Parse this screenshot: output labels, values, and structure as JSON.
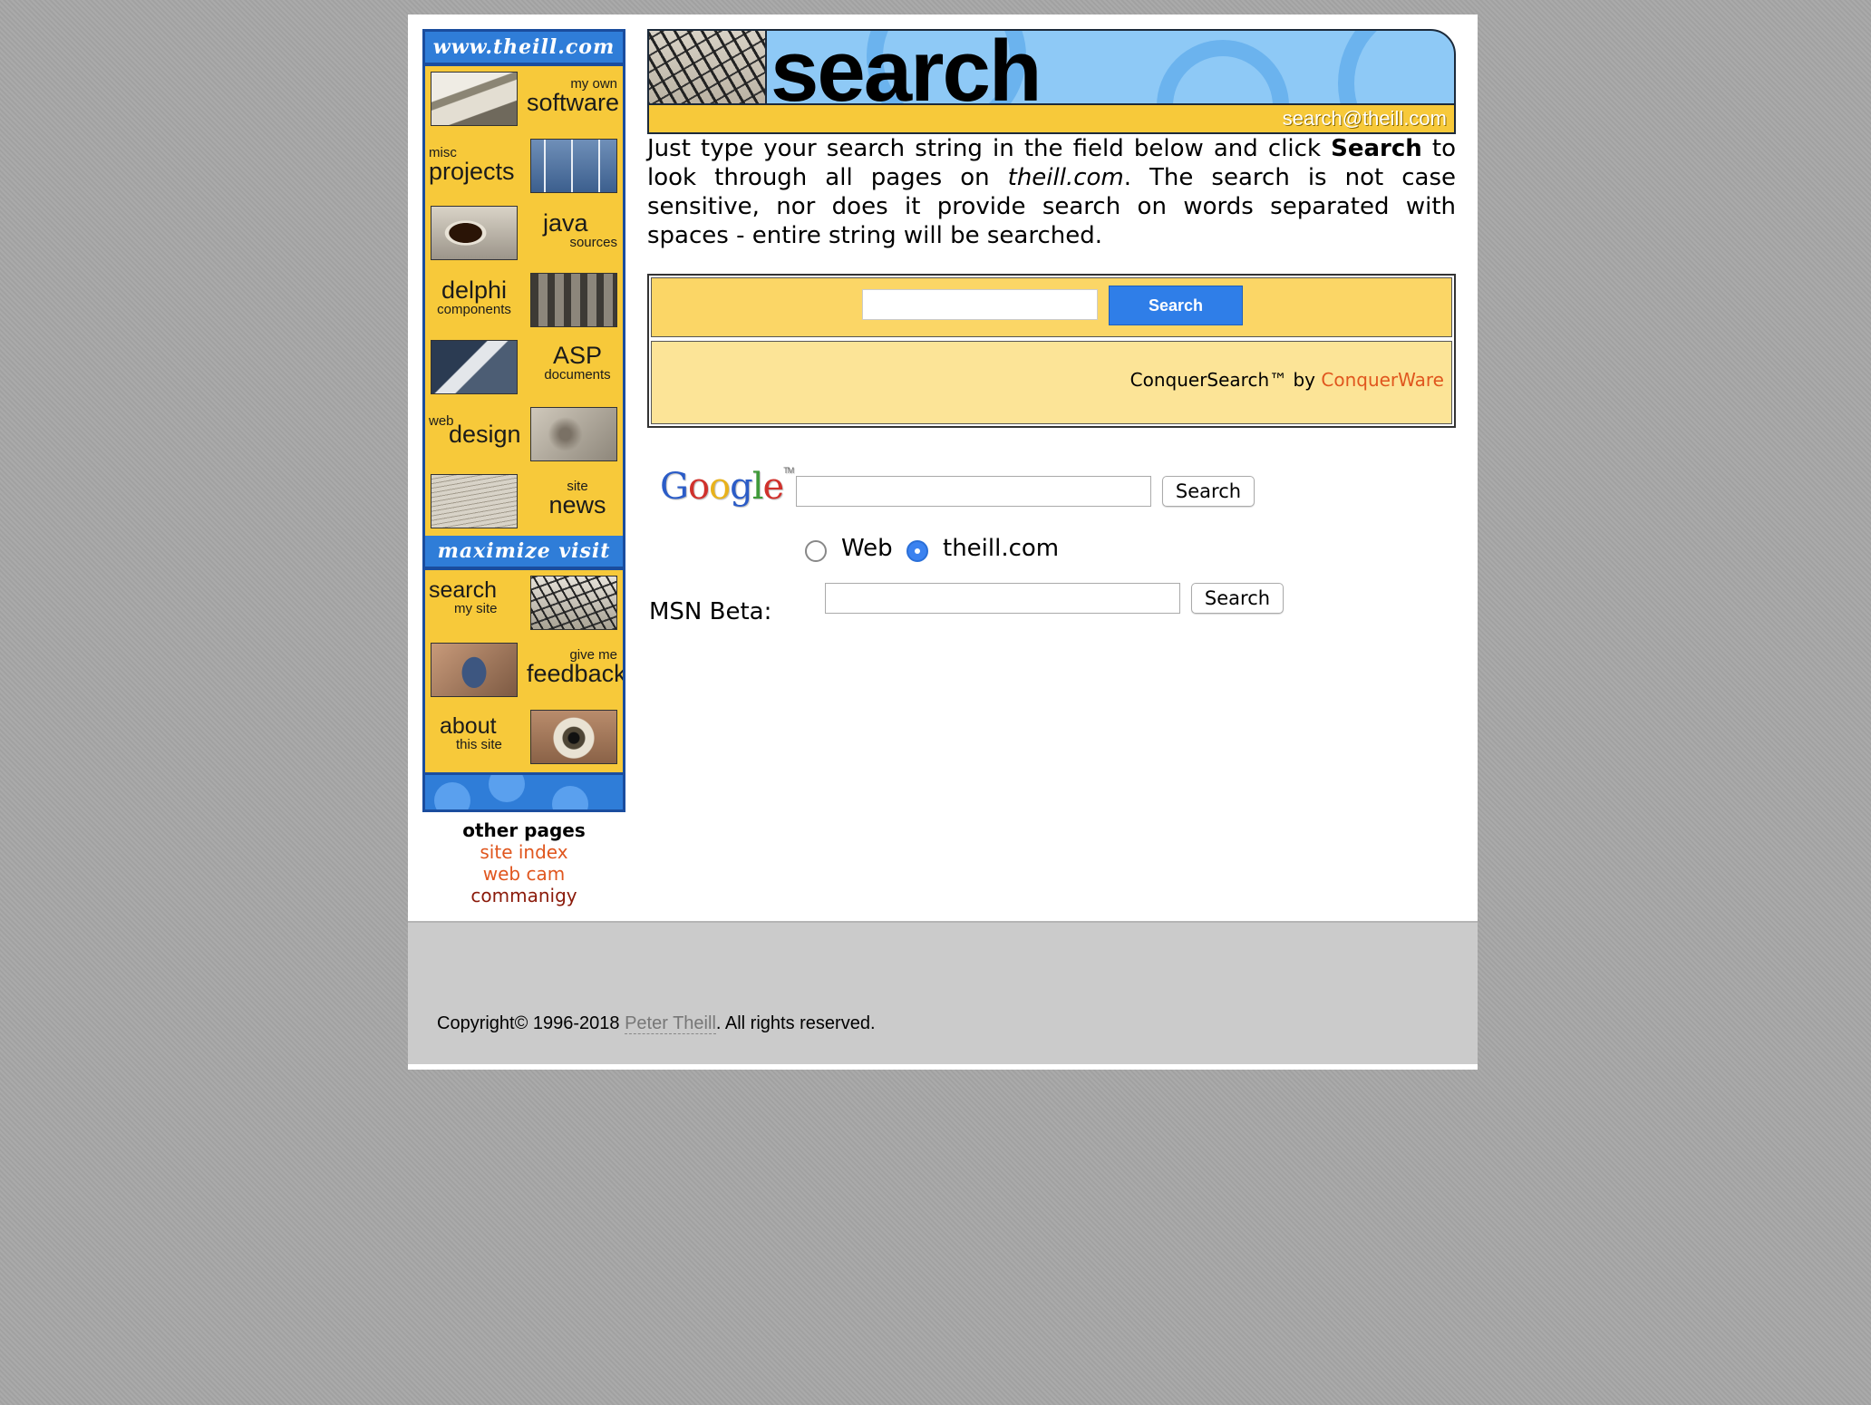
{
  "nav": {
    "header": "www.theill.com",
    "items": [
      {
        "small": "my own",
        "big": "software",
        "image": "software-box-photo"
      },
      {
        "small": "misc",
        "big": "projects",
        "image": "wind-turbines-photo"
      },
      {
        "small": "",
        "big": "java",
        "sub": "sources",
        "image": "coffee-cup-photo"
      },
      {
        "small": "",
        "big": "delphi",
        "sub": "components",
        "image": "ruins-photo"
      },
      {
        "small": "",
        "big": "ASP",
        "sub": "documents",
        "image": "bird-photo"
      },
      {
        "small": "web",
        "big": "design",
        "image": "sketch-photo"
      },
      {
        "small": "site",
        "big": "news",
        "image": "newspaper-photo"
      }
    ],
    "section2_header": "maximize visit",
    "items2": [
      {
        "big": "search",
        "sub": "my site",
        "image": "dome-structure-photo"
      },
      {
        "small": "give me",
        "big": "feedback",
        "image": "phone-photo"
      },
      {
        "big": "about",
        "sub": "this site",
        "image": "eye-photo"
      }
    ]
  },
  "other_pages": {
    "heading": "other pages",
    "links": [
      "site index",
      "web cam",
      "commanigy"
    ]
  },
  "banner": {
    "title": "search",
    "email": "search@theill.com"
  },
  "intro": {
    "part1": "Just type your search string in the field below and click ",
    "bold": "Search",
    "part2": " to look through all pages on ",
    "italic": "theill.com",
    "part3": ". The search is not case sensitive, nor does it provide search on words separated with spaces - entire string will be searched."
  },
  "conquer": {
    "input_value": "",
    "button": "Search",
    "credit_prefix": "ConquerSearch™ by ",
    "credit_link": "ConquerWare"
  },
  "google": {
    "logo": [
      "G",
      "o",
      "o",
      "g",
      "l",
      "e"
    ],
    "tm": "TM",
    "input_value": "",
    "button": "Search",
    "radio_web": "Web",
    "radio_site": "theill.com",
    "selected": "theill.com"
  },
  "msn": {
    "label": "MSN Beta:",
    "input_value": "",
    "button": "Search"
  },
  "footer": {
    "copyright_prefix": "Copyright© 1996-2018 ",
    "author": "Peter Theill",
    "copyright_suffix": ". All rights reserved."
  },
  "colors": {
    "nav_yellow": "#f7c93a",
    "nav_blue": "#2f7dd8",
    "link_orange": "#e0561e",
    "conquer_button": "#2f7ee8"
  }
}
